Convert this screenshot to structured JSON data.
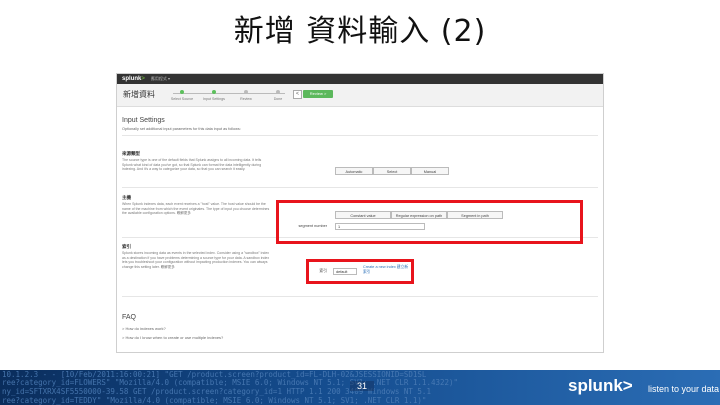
{
  "slide": {
    "title": "新增 資料輸入 (2)",
    "page_number": "31"
  },
  "splunk_app": {
    "logo": "splunk",
    "logo_mark": ">",
    "app_menu": "應用程式 ▾",
    "page_title": "新增資料",
    "steps": [
      {
        "label": "Select Source",
        "active": true
      },
      {
        "label": "Input Settings",
        "active": true
      },
      {
        "label": "Review",
        "active": false
      },
      {
        "label": "Done",
        "active": false
      }
    ],
    "back_label": "<",
    "next_label": "Review >",
    "accent_green": "#5cb85c",
    "input_settings": {
      "heading": "Input Settings",
      "description": "Optionally set additional input parameters for this data input as follows:"
    },
    "source_type": {
      "heading": "來源類型",
      "text": "The source type is one of the default fields that Splunk assigns to all incoming data. It tells Splunk what kind of data you've got, so that Splunk can format the data intelligently during indexing. And it's a way to categorize your data, so that you can search it easily.",
      "options": [
        "Automatic",
        "Select",
        "Manual"
      ]
    },
    "host": {
      "heading": "主機",
      "text": "When Splunk indexes data, each event receives a \"host\" value. The host value should be the name of the machine from which the event originates. The type of input you choose determines the available configuration options. 瞭解更多",
      "options": [
        "Constant value",
        "Regular expression on path",
        "Segment in path"
      ],
      "segment_label": "segment number",
      "segment_value": "1"
    },
    "index": {
      "heading": "索引",
      "text": "Splunk stores incoming data as events in the selected index. Consider using a \"sandbox\" index as a destination if you have problems determining a source type for your data. A sandbox index lets you troubleshoot your configuration without impacting production indexes. You can always change this setting later. 瞭解更多",
      "label": "索引",
      "selected": "default",
      "create_link": "Create a new index 建立新索引"
    },
    "faq": {
      "heading": "FAQ",
      "items": [
        "> How do indexes work?",
        "> How do I know when to create or use multiple indexes?"
      ]
    },
    "highlight_color": "#e8141c"
  },
  "footer": {
    "brand": "splunk",
    "brand_mark": ">",
    "tagline": "listen to your data",
    "log_lines": [
      "10.1.2.3 - - [10/Feb/2011:16:00:21] \"GET /product.screen?product_id=FL-DLH-02&JSESSIONID=SD1SL",
      "ree?category_id=FLOWERS\" \"Mozilla/4.0 (compatible; MSIE 6.0; Windows NT 5.1; SV1; .NET CLR 1.1.4322)\"",
      "ny_id=SFTXRX4SF5550000-39.58 GET /product.screen?category_id=1 HTTP 1.1 200 3409 Windows NT 5.1",
      "ree?category_id=TEDDY\" \"Mozilla/4.0 (compatible; MSIE 6.0; Windows NT 5.1; SV1; .NET CLR 1.1)\""
    ]
  }
}
